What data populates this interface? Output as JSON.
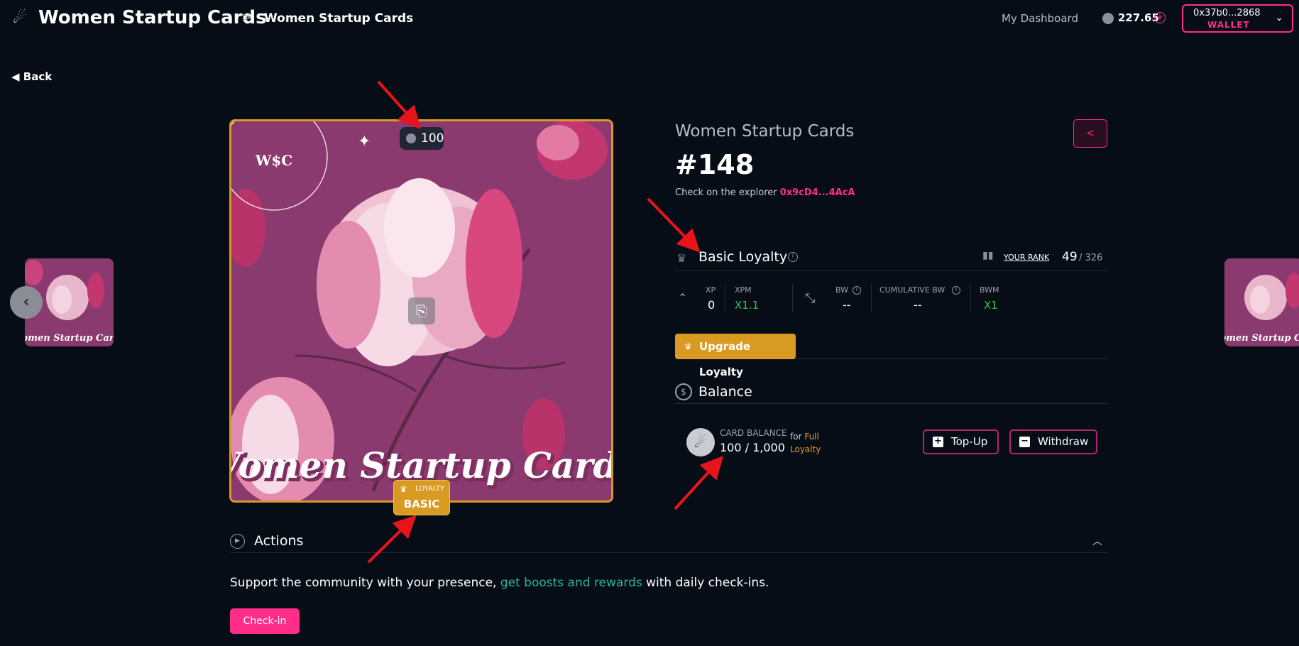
{
  "header": {
    "app_title": "Women Startup Cards",
    "breadcrumb_separator": ">",
    "breadcrumb_current": "Women Startup Cards",
    "dashboard_link": "My Dashboard",
    "coin_balance": "227.65",
    "wallet_address": "0x37b0...2868",
    "wallet_label": "WALLET"
  },
  "back_label": "Back",
  "card": {
    "price": "100",
    "brand_mark": "W$C",
    "art_title": "Women Startup Cards",
    "loyalty_badge_small": "LOYALTY",
    "loyalty_badge_level": "BASIC",
    "thumb_caption": "Women Startup Cards"
  },
  "details": {
    "collection_name": "Women Startup Cards",
    "token_id": "#148",
    "explorer_label": "Check on the explorer",
    "explorer_address": "0x9cD4...4AcA"
  },
  "loyalty": {
    "title": "Basic Loyalty",
    "rank_label": "YOUR RANK",
    "rank_value": "49",
    "rank_total": "/ 326",
    "stats": {
      "xp_label": "XP",
      "xp_value": "0",
      "xpm_label": "XPM",
      "xpm_value": "X1.1",
      "bw_label": "BW",
      "bw_value": "--",
      "cbw_label": "CUMULATIVE BW",
      "cbw_value": "--",
      "bwm_label": "BWM",
      "bwm_value": "X1"
    },
    "upgrade_label": "Upgrade Loyalty"
  },
  "balance": {
    "title": "Balance",
    "card_balance_label": "CARD BALANCE",
    "card_balance_value": "100 / 1,000",
    "for_text": "for",
    "full_text": "Full",
    "loyalty_text": "Loyalty",
    "topup_label": "Top-Up",
    "withdraw_label": "Withdraw"
  },
  "actions": {
    "title": "Actions",
    "support_prefix": "Support the community with your presence,",
    "support_link": "get boosts and rewards",
    "support_suffix": "with daily check-ins.",
    "checkin_label": "Check-in"
  },
  "colors": {
    "accent": "#ff2d87",
    "gold": "#d99a21",
    "green": "#33c14a",
    "link": "#2bb39a",
    "background": "#070d17"
  }
}
